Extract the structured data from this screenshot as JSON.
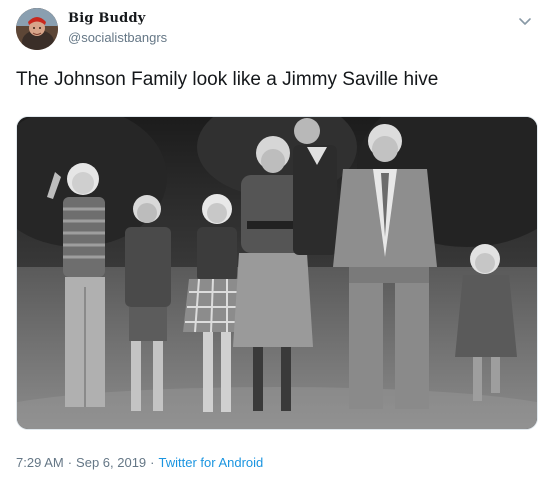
{
  "author": {
    "display_name": "Big Buddy",
    "handle": "@socialistbangrs",
    "avatar_icon": "profile-avatar"
  },
  "tweet": {
    "text": "The Johnson Family look like a Jimmy Saville hive",
    "photo_alt_icon": "family-photo"
  },
  "meta": {
    "time": "7:29 AM",
    "separator": "·",
    "date": "Sep 6, 2019",
    "source": "Twitter for Android"
  },
  "colors": {
    "text": "#14171a",
    "secondary": "#657786",
    "link": "#1b95e0"
  },
  "icons": {
    "menu": "chevron-down-icon"
  }
}
